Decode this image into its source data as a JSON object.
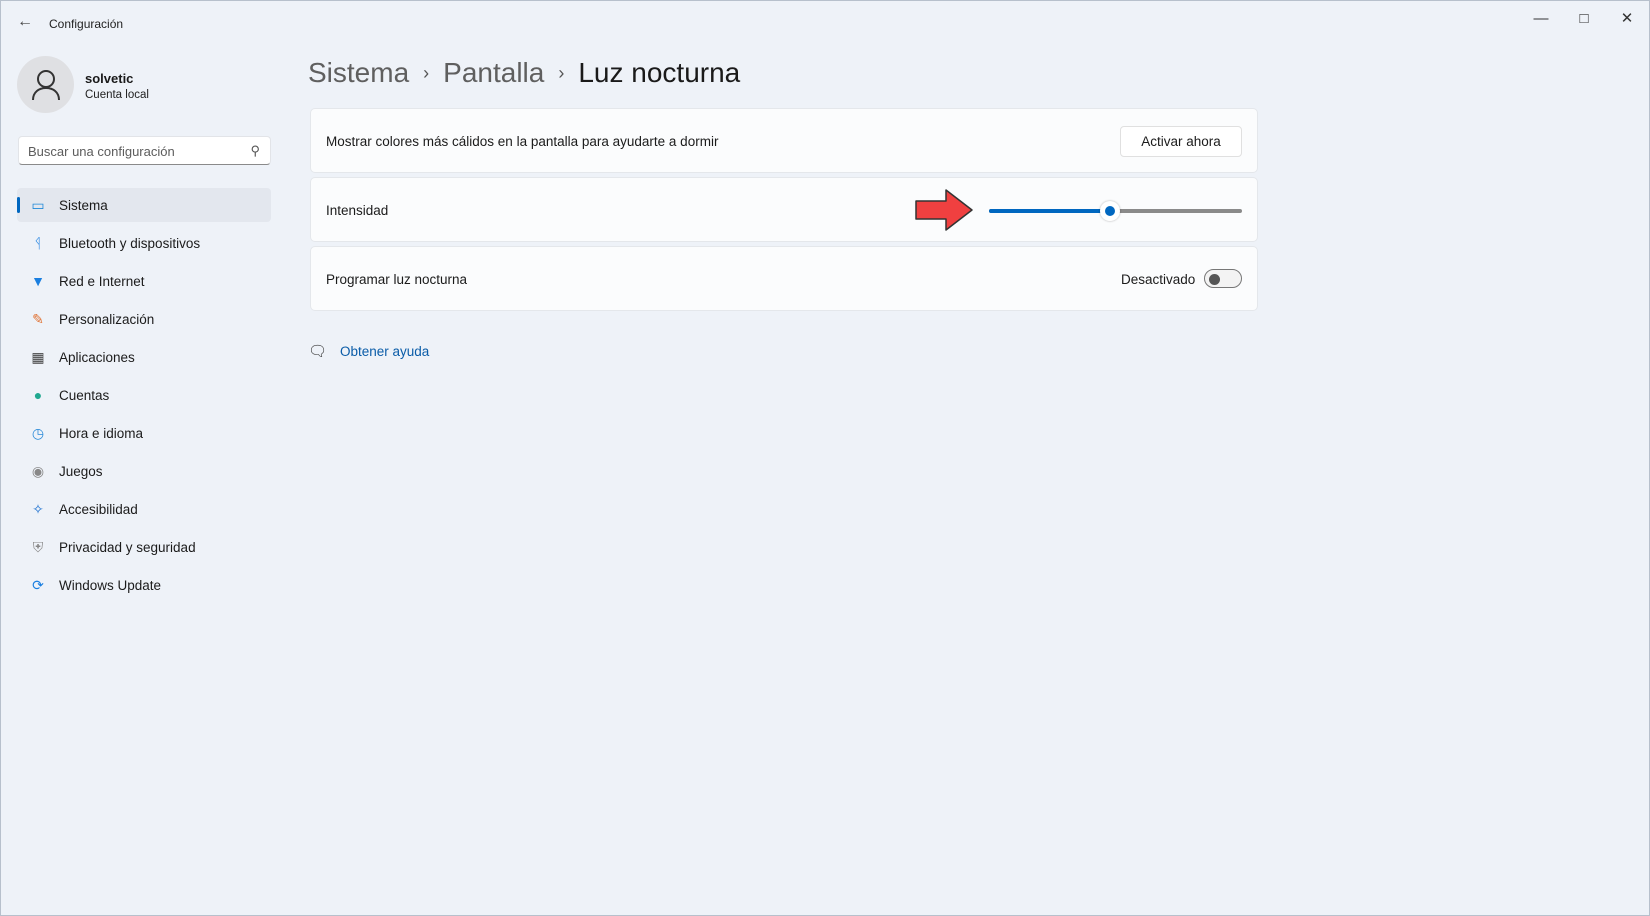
{
  "window": {
    "title": "Configuración",
    "controls": [
      "minimize",
      "maximize",
      "close"
    ]
  },
  "user": {
    "name": "solvetic",
    "type": "Cuenta local"
  },
  "search": {
    "placeholder": "Buscar una configuración"
  },
  "sidebar": {
    "items": [
      {
        "label": "Sistema",
        "icon": "monitor-icon",
        "selected": true
      },
      {
        "label": "Bluetooth y dispositivos",
        "icon": "bluetooth-icon"
      },
      {
        "label": "Red e Internet",
        "icon": "wifi-icon"
      },
      {
        "label": "Personalización",
        "icon": "brush-icon"
      },
      {
        "label": "Aplicaciones",
        "icon": "apps-icon"
      },
      {
        "label": "Cuentas",
        "icon": "person-icon"
      },
      {
        "label": "Hora e idioma",
        "icon": "clock-globe-icon"
      },
      {
        "label": "Juegos",
        "icon": "gamepad-icon"
      },
      {
        "label": "Accesibilidad",
        "icon": "accessibility-icon"
      },
      {
        "label": "Privacidad y seguridad",
        "icon": "shield-icon"
      },
      {
        "label": "Windows Update",
        "icon": "update-icon"
      }
    ]
  },
  "breadcrumb": [
    "Sistema",
    "Pantalla",
    "Luz nocturna"
  ],
  "settings": {
    "warm": {
      "label": "Mostrar colores más cálidos en la pantalla para ayudarte a dormir",
      "button": "Activar ahora"
    },
    "intensity": {
      "label": "Intensidad",
      "value_percent": 48
    },
    "schedule": {
      "label": "Programar luz nocturna",
      "state": "Desactivado",
      "on": false
    }
  },
  "help": {
    "label": "Obtener ayuda"
  },
  "colors": {
    "accent": "#0067c0",
    "annotation_arrow": "#f04040"
  }
}
